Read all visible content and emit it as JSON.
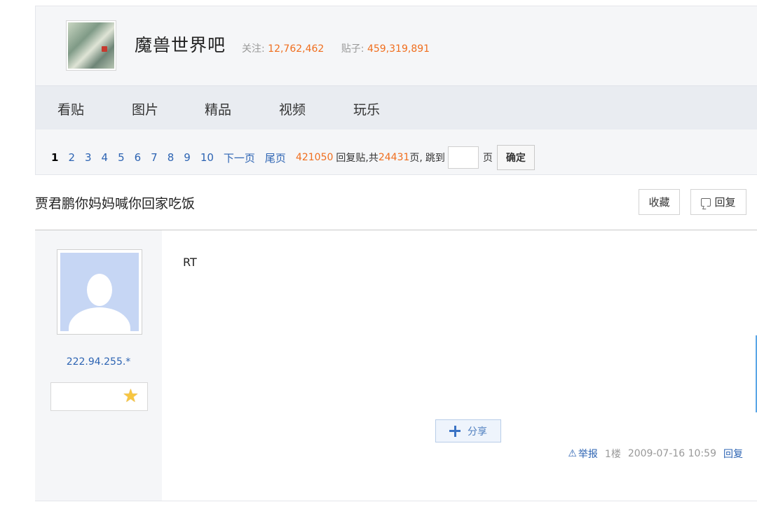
{
  "forum": {
    "name": "魔兽世界吧",
    "follow_label": "关注:",
    "follow_count": "12,762,462",
    "posts_label": "贴子:",
    "posts_count": "459,319,891"
  },
  "nav": {
    "tabs": [
      {
        "label": "看贴"
      },
      {
        "label": "图片"
      },
      {
        "label": "精品"
      },
      {
        "label": "视频"
      },
      {
        "label": "玩乐"
      }
    ]
  },
  "pager": {
    "pages": [
      "1",
      "2",
      "3",
      "4",
      "5",
      "6",
      "7",
      "8",
      "9",
      "10"
    ],
    "current": "1",
    "next_label": "下一页",
    "last_label": "尾页",
    "reply_count": "421050",
    "reply_label": "回复贴,共",
    "page_count": "24431",
    "page_suffix": "页,",
    "jump_label": "跳到",
    "jump_value": "",
    "page_unit": "页",
    "confirm_label": "确定"
  },
  "thread": {
    "title": "贾君鹏你妈妈喊你回家吃饭",
    "favorite_label": "收藏",
    "reply_label": "回复"
  },
  "post": {
    "user_ip": "222.94.255.*",
    "content": "RT",
    "share_label": "分享",
    "report_label": "举报",
    "floor": "1楼",
    "time": "2009-07-16 10:59",
    "reply_label": "回复"
  },
  "icons": {
    "forum_avatar": "forum-logo-image",
    "user_avatar": "default-user-icon",
    "badge": "star-icon",
    "share": "plus-icon",
    "report": "warning-icon",
    "reply": "comment-icon"
  },
  "colors": {
    "link": "#2d64b3",
    "highlight": "#f06e1e",
    "header_bg": "#f5f6f8",
    "nav_bg": "#e9ecf1"
  }
}
